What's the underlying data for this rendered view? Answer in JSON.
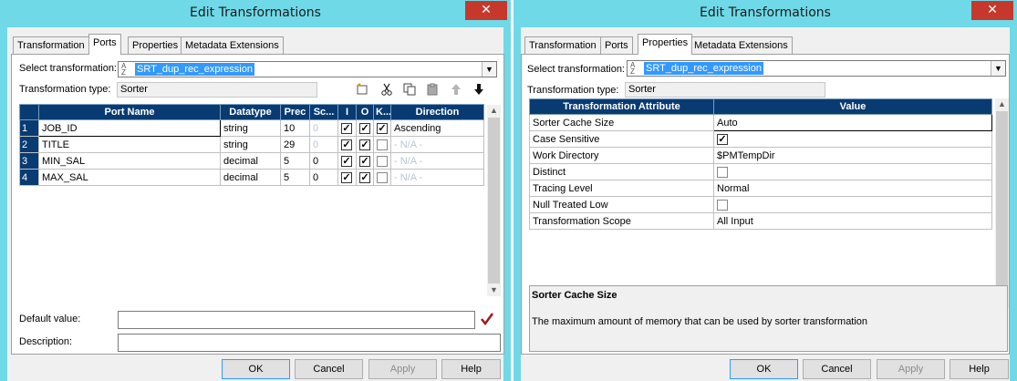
{
  "left": {
    "title": "Edit Transformations",
    "close": "✕",
    "tabs": [
      "Transformation",
      "Ports",
      "Properties",
      "Metadata Extensions"
    ],
    "active_tab": "Ports",
    "select_label": "Select transformation:",
    "select_value": "SRT_dup_rec_expression",
    "type_label": "Transformation type:",
    "type_value": "Sorter",
    "columns": [
      "Port Name",
      "Datatype",
      "Prec",
      "Sc...",
      "I",
      "O",
      "K...",
      "Direction"
    ],
    "rows": [
      {
        "num": "1",
        "name": "JOB_ID",
        "datatype": "string",
        "prec": "10",
        "scale": "0",
        "i": true,
        "o": true,
        "k": true,
        "direction": "Ascending"
      },
      {
        "num": "2",
        "name": "TITLE",
        "datatype": "string",
        "prec": "29",
        "scale": "0",
        "i": true,
        "o": true,
        "k": false,
        "direction": "- N/A -"
      },
      {
        "num": "3",
        "name": "MIN_SAL",
        "datatype": "decimal",
        "prec": "5",
        "scale": "0",
        "i": true,
        "o": true,
        "k": false,
        "direction": "- N/A -"
      },
      {
        "num": "4",
        "name": "MAX_SAL",
        "datatype": "decimal",
        "prec": "5",
        "scale": "0",
        "i": true,
        "o": true,
        "k": false,
        "direction": "- N/A -"
      }
    ],
    "default_label": "Default value:",
    "description_label": "Description:",
    "buttons": {
      "ok": "OK",
      "cancel": "Cancel",
      "apply": "Apply",
      "help": "Help"
    }
  },
  "right": {
    "title": "Edit Transformations",
    "close": "✕",
    "tabs": [
      "Transformation",
      "Ports",
      "Properties",
      "Metadata Extensions"
    ],
    "active_tab": "Properties",
    "select_label": "Select transformation:",
    "select_value": "SRT_dup_rec_expression",
    "type_label": "Transformation type:",
    "type_value": "Sorter",
    "columns": [
      "Transformation Attribute",
      "Value"
    ],
    "rows": [
      {
        "attr": "Sorter Cache Size",
        "value": "Auto"
      },
      {
        "attr": "Case Sensitive",
        "checkbox": true,
        "checked": true
      },
      {
        "attr": "Work Directory",
        "value": "$PMTempDir"
      },
      {
        "attr": "Distinct",
        "checkbox": true,
        "checked": false
      },
      {
        "attr": "Tracing Level",
        "value": "Normal"
      },
      {
        "attr": "Null Treated Low",
        "checkbox": true,
        "checked": false
      },
      {
        "attr": "Transformation Scope",
        "value": "All Input"
      }
    ],
    "desc_title": "Sorter Cache Size",
    "desc_text": "The maximum amount of memory that can be used by sorter transformation",
    "buttons": {
      "ok": "OK",
      "cancel": "Cancel",
      "apply": "Apply",
      "help": "Help"
    }
  },
  "glyphs": {
    "check": "✓",
    "dropdown": "▼",
    "up": "▲",
    "down": "▼"
  },
  "colors": {
    "title_bar": "#6fd9e8",
    "close_button": "#c7382c",
    "grid_header": "#083b72",
    "selection": "#3399ff",
    "default_check": "#9b1b1b"
  },
  "icons": [
    "new-port-icon",
    "cut-icon",
    "copy-icon",
    "paste-icon",
    "move-up-icon",
    "move-down-icon",
    "validate-checkmark-icon"
  ]
}
